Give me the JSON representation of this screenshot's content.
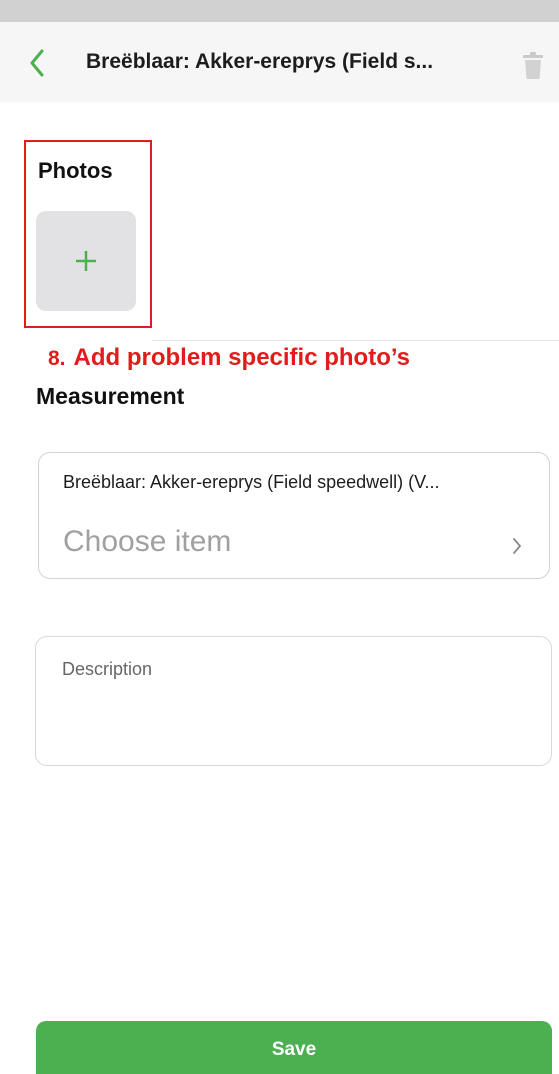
{
  "nav": {
    "title": "Breëblaar: Akker-ereprys (Field s...",
    "back_icon": "chevron-left-icon",
    "delete_icon": "trash-icon"
  },
  "photos": {
    "title": "Photos",
    "add_icon": "plus-icon"
  },
  "annotation": {
    "number": "8.",
    "text": "Add problem specific photo’s"
  },
  "measurement": {
    "title": "Measurement",
    "select": {
      "label": "Breëblaar: Akker-ereprys (Field speedwell) (V...",
      "placeholder": "Choose item",
      "chevron_icon": "chevron-right-icon"
    }
  },
  "description": {
    "placeholder": "Description"
  },
  "save_button": {
    "label": "Save"
  },
  "colors": {
    "accent_green": "#4caf50",
    "annotation_red": "#e21b1b",
    "nav_background": "#f6f6f6",
    "tile_background": "#e2e2e4"
  }
}
